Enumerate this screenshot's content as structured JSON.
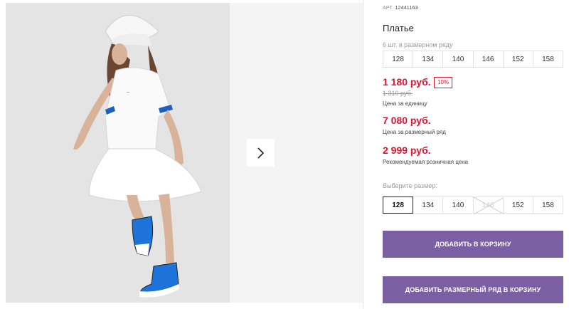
{
  "product": {
    "article_label": "АРТ.",
    "article_number": "12441163",
    "title": "Платье"
  },
  "size_row": {
    "hint": "6 шт. в размерном ряду",
    "sizes": [
      "128",
      "134",
      "140",
      "146",
      "152",
      "158"
    ]
  },
  "prices": {
    "unit_price": "1 180 руб.",
    "discount_badge": "10%",
    "old_price": "1 310 руб.",
    "unit_caption": "Цена за единицу",
    "row_price": "7 080 руб.",
    "row_caption": "Цена за размерный ряд",
    "rrp_price": "2 999 руб.",
    "rrp_caption": "Рекомендуемая розничная цена"
  },
  "size_select": {
    "hint": "Выберите размер:",
    "options": [
      {
        "label": "128",
        "state": "selected"
      },
      {
        "label": "134",
        "state": "available"
      },
      {
        "label": "140",
        "state": "available"
      },
      {
        "label": "146",
        "state": "unavailable"
      },
      {
        "label": "152",
        "state": "available"
      },
      {
        "label": "158",
        "state": "available"
      }
    ]
  },
  "buttons": {
    "add_to_cart": "ДОБАВИТЬ В КОРЗИНУ",
    "add_row_to_cart": "ДОБАВИТЬ РАЗМЕРНЫЙ РЯД В КОРЗИНУ"
  },
  "colors": {
    "accent": "#7b5fa3",
    "price_red": "#e0142f"
  },
  "icons": {
    "next": "chevron-right-icon"
  }
}
